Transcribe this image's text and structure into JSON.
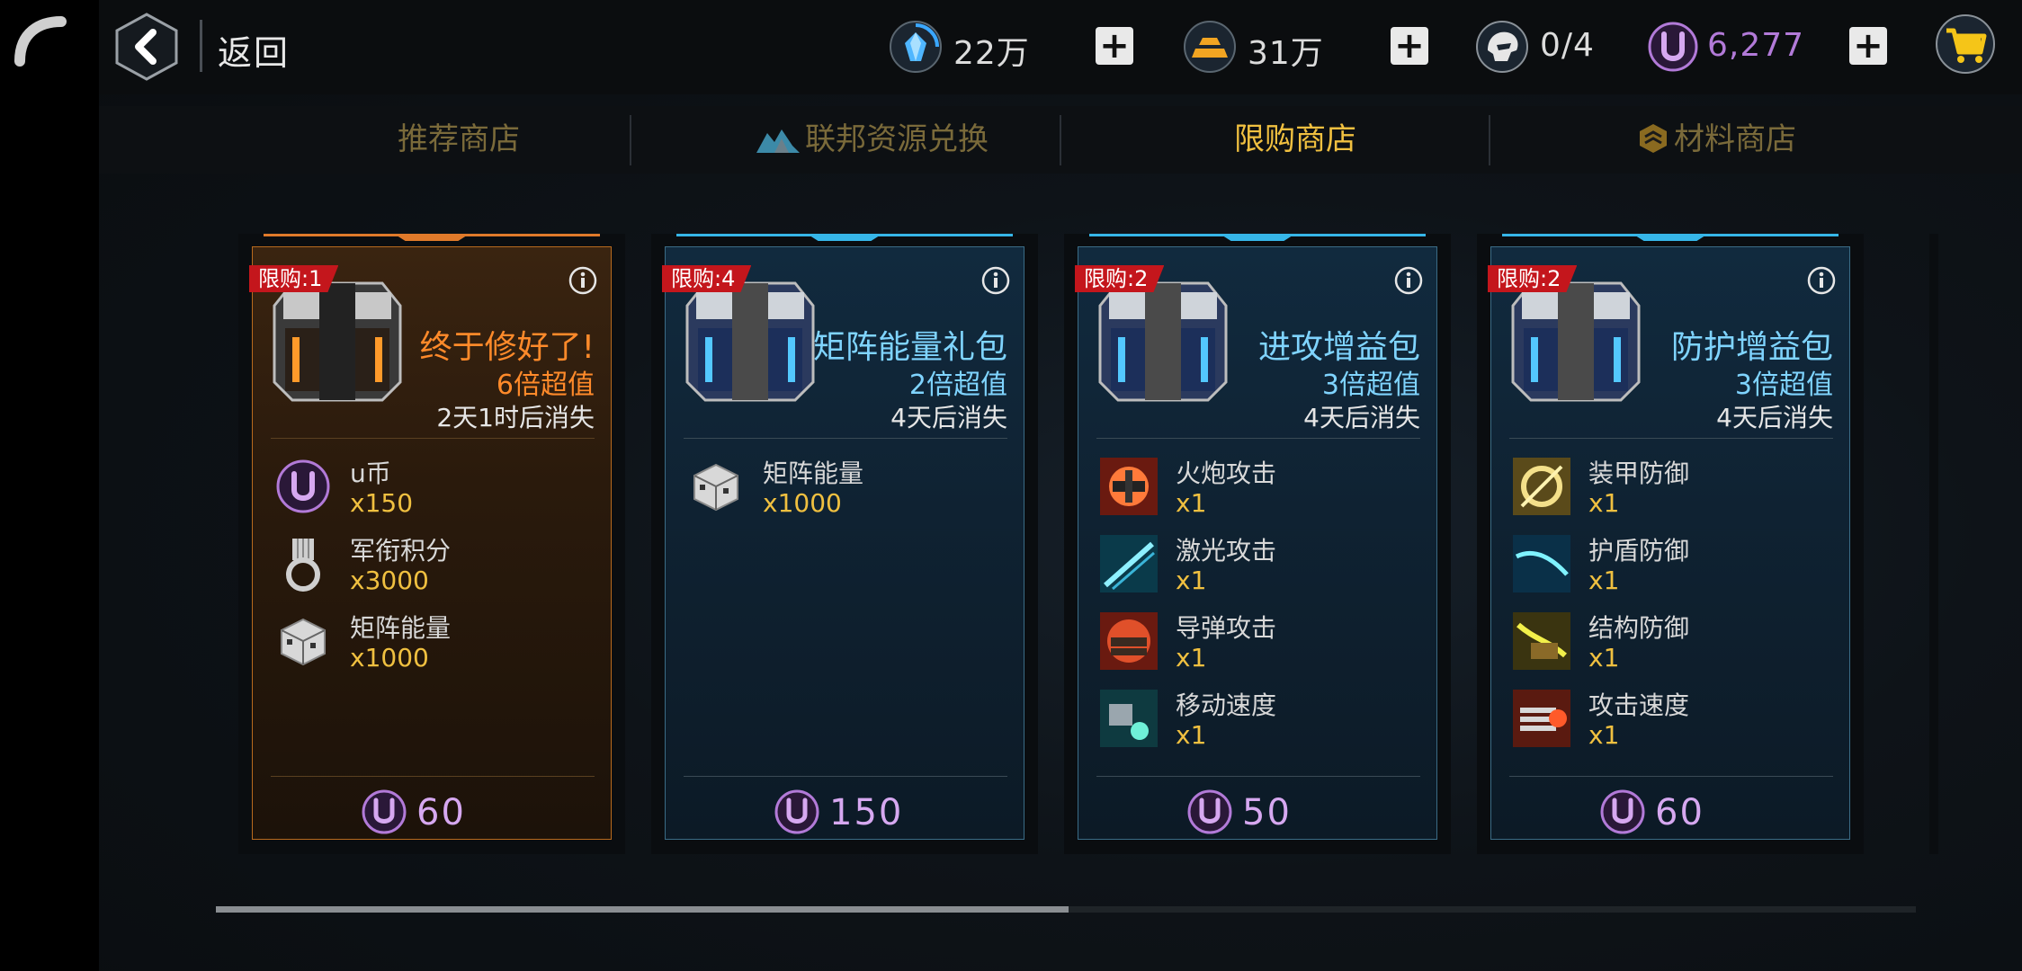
{
  "header": {
    "back_label": "返回",
    "resources": [
      {
        "name": "crystal",
        "icon": "crystal-icon",
        "value": "22万"
      },
      {
        "name": "gold",
        "icon": "gold-bar-icon",
        "value": "31万"
      },
      {
        "name": "pilot",
        "icon": "pilot-helmet-icon",
        "value": "0/4"
      },
      {
        "name": "u-coin",
        "icon": "u-coin-icon",
        "value": "6,277"
      }
    ],
    "cart_icon": "shopping-cart-icon"
  },
  "tabs": [
    {
      "label": "推荐商店",
      "active": false
    },
    {
      "label": "联邦资源兑换",
      "active": false,
      "icon": "mountain-resource-icon"
    },
    {
      "label": "限购商店",
      "active": true
    },
    {
      "label": "材料商店",
      "active": false,
      "icon": "rank-badge-icon"
    }
  ],
  "cards": [
    {
      "style": "gold",
      "limit": "限购:1",
      "title": "终于修好了!",
      "value": "6倍超值",
      "expire": "2天1时后消失",
      "items": [
        {
          "icon": "u-coin-icon",
          "name": "u币",
          "qty": "x150"
        },
        {
          "icon": "medal-icon",
          "name": "军衔积分",
          "qty": "x3000"
        },
        {
          "icon": "matrix-cube-icon",
          "name": "矩阵能量",
          "qty": "x1000"
        }
      ],
      "price": "60"
    },
    {
      "style": "blue",
      "limit": "限购:4",
      "title": "矩阵能量礼包",
      "value": "2倍超值",
      "expire": "4天后消失",
      "items": [
        {
          "icon": "matrix-cube-icon",
          "name": "矩阵能量",
          "qty": "x1000"
        }
      ],
      "price": "150"
    },
    {
      "style": "blue",
      "limit": "限购:2",
      "title": "进攻增益包",
      "value": "3倍超值",
      "expire": "4天后消失",
      "items": [
        {
          "icon": "cannon-attack-icon",
          "name": "火炮攻击",
          "qty": "x1"
        },
        {
          "icon": "laser-attack-icon",
          "name": "激光攻击",
          "qty": "x1"
        },
        {
          "icon": "missile-attack-icon",
          "name": "导弹攻击",
          "qty": "x1"
        },
        {
          "icon": "move-speed-icon",
          "name": "移动速度",
          "qty": "x1"
        }
      ],
      "price": "50"
    },
    {
      "style": "blue",
      "limit": "限购:2",
      "title": "防护增益包",
      "value": "3倍超值",
      "expire": "4天后消失",
      "items": [
        {
          "icon": "armor-defense-icon",
          "name": "装甲防御",
          "qty": "x1"
        },
        {
          "icon": "shield-defense-icon",
          "name": "护盾防御",
          "qty": "x1"
        },
        {
          "icon": "structure-defense-icon",
          "name": "结构防御",
          "qty": "x1"
        },
        {
          "icon": "attack-speed-icon",
          "name": "攻击速度",
          "qty": "x1"
        }
      ],
      "price": "60"
    }
  ],
  "colors": {
    "accent_gold": "#f0c040",
    "accent_blue": "#7fd4ff",
    "accent_orange": "#ff8a2a",
    "u_coin_purple": "#b27ad8",
    "limit_red": "#c4161c"
  }
}
